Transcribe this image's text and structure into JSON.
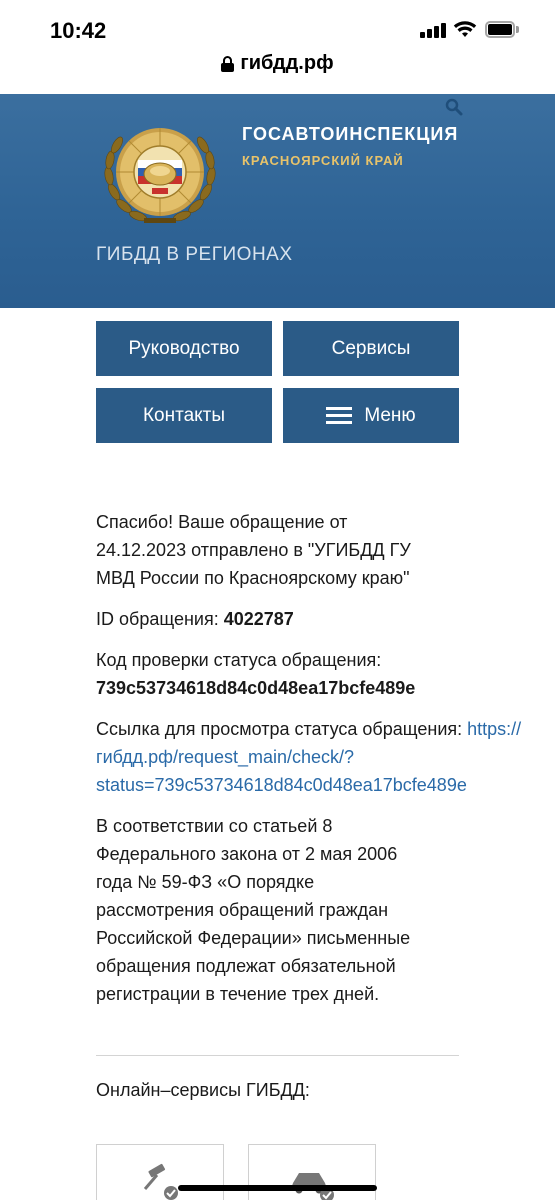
{
  "status_bar": {
    "time": "10:42"
  },
  "browser": {
    "url": "гибдд.рф"
  },
  "header": {
    "org_title": "ГОСАВТОИНСПЕКЦИЯ",
    "org_region": "КРАСНОЯРСКИЙ КРАЙ",
    "regions_link": "ГИБДД В РЕГИОНАХ"
  },
  "nav": {
    "leadership": "Руководство",
    "services": "Сервисы",
    "contacts": "Контакты",
    "menu": "Меню"
  },
  "message": {
    "thanks_line1": "Спасибо! Ваше обращение от",
    "thanks_line2": "24.12.2023 отправлено в \"УГИБДД ГУ",
    "thanks_line3": "МВД России по Красноярскому краю\"",
    "id_label": "ID обращения: ",
    "id_value": "4022787",
    "code_label": "Код проверки статуса обращения:",
    "code_value": "739c53734618d84c0d48ea17bcfe489e",
    "link_label": "Ссылка для просмотра статуса обращения: ",
    "link_line1": "https://",
    "link_line2": "гибдд.рф/request_main/check/?",
    "link_line3": "status=739c53734618d84c0d48ea17bcfe489e",
    "law_line1": "В соответствии со статьей 8",
    "law_line2": "Федерального закона от 2 мая 2006",
    "law_line3": "года № 59-ФЗ «О порядке",
    "law_line4": "рассмотрения обращений граждан",
    "law_line5": "Российской Федерации» письменные",
    "law_line6": "обращения подлежат обязательной",
    "law_line7": "регистрации в течение трех дней."
  },
  "services": {
    "title": "Онлайн–сервисы ГИБДД:"
  },
  "colors": {
    "header_blue": "#2f6496",
    "button_blue": "#2b5b87",
    "link_blue": "#2a6aa8",
    "region_gold": "#e8c36a"
  }
}
